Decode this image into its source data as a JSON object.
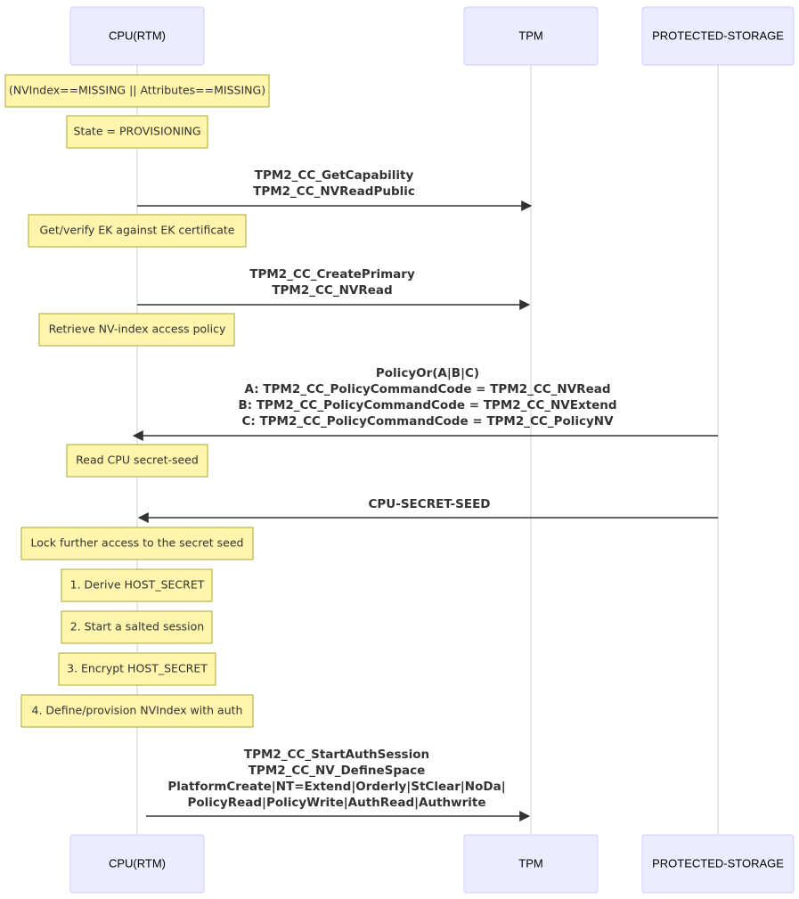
{
  "participants": [
    "CPU(RTM)",
    "TPM",
    "PROTECTED-STORAGE"
  ],
  "notes": [
    "(NVIndex==MISSING || Attributes==MISSING)",
    "State = PROVISIONING",
    "Get/verify EK against EK certificate",
    "Retrieve NV-index access policy",
    "Read CPU secret-seed",
    "Lock further access to the secret seed",
    "1. Derive HOST_SECRET",
    "2. Start a salted session",
    "3. Encrypt HOST_SECRET",
    "4. Define/provision NVIndex with auth"
  ],
  "messages": [
    {
      "from": "CPU(RTM)",
      "to": "TPM",
      "lines": [
        "TPM2_CC_GetCapability",
        "TPM2_CC_NVReadPublic"
      ]
    },
    {
      "from": "CPU(RTM)",
      "to": "TPM",
      "lines": [
        "TPM2_CC_CreatePrimary",
        "TPM2_CC_NVRead"
      ]
    },
    {
      "from": "PROTECTED-STORAGE",
      "to": "CPU(RTM)",
      "lines": [
        "PolicyOr(A|B|C)",
        "A: TPM2_CC_PolicyCommandCode = TPM2_CC_NVRead",
        "B: TPM2_CC_PolicyCommandCode = TPM2_CC_NVExtend",
        "C: TPM2_CC_PolicyCommandCode = TPM2_CC_PolicyNV"
      ]
    },
    {
      "from": "PROTECTED-STORAGE",
      "to": "CPU(RTM)",
      "lines": [
        "CPU-SECRET-SEED"
      ]
    },
    {
      "from": "CPU(RTM)",
      "to": "TPM",
      "lines": [
        "TPM2_CC_StartAuthSession",
        "TPM2_CC_NV_DefineSpace",
        "PlatformCreate|NT=Extend|Orderly|StClear|NoDa|",
        "PolicyRead|PolicyWrite|AuthRead|Authwrite"
      ]
    }
  ],
  "colors": {
    "actor_fill": "#ECECFF",
    "actor_border": "#CCCCFF",
    "note_fill": "#fff5ad",
    "note_border": "#aaaa33",
    "line": "#333333"
  }
}
